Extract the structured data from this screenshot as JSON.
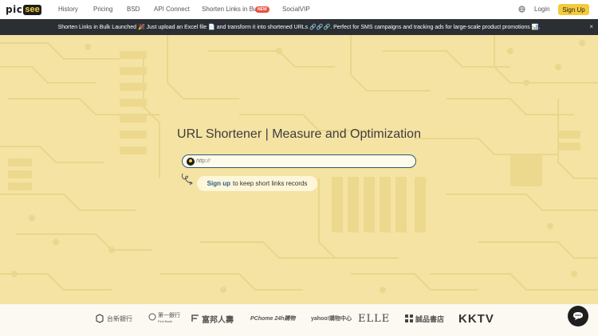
{
  "brand": {
    "logo_main": "pic",
    "logo_accent": "see"
  },
  "nav": {
    "items": [
      "History",
      "Pricing",
      "BSD",
      "API Connect",
      "Shorten Links in Bulk",
      "SocialVIP"
    ],
    "new_badge": "NEW",
    "login": "Login",
    "signup": "Sign Up"
  },
  "announcement": {
    "text": "Shorten Links in Bulk Launched 🎉 Just upload an Excel file 📄 and transform it into shortened URLs 🔗🔗🔗. Perfect for SMS campaigns and tracking ads for large-scale product promotions 📊.",
    "close": "×"
  },
  "hero": {
    "title": "URL Shortener | Measure and Optimization",
    "input_placeholder": "http://",
    "signup_link": "Sign up",
    "signup_suffix": "to keep short links records"
  },
  "partners": [
    "台新銀行",
    "第一銀行",
    "First Bank",
    "富邦人壽",
    "PChome 24h購物",
    "yahoo!購物中心",
    "ELLE",
    "誠品書店",
    "KKTV"
  ],
  "colors": {
    "accent": "#f4cc3a",
    "background": "#f5e3a3",
    "announce_bg": "#2b2f33",
    "link": "#2b5e86"
  }
}
